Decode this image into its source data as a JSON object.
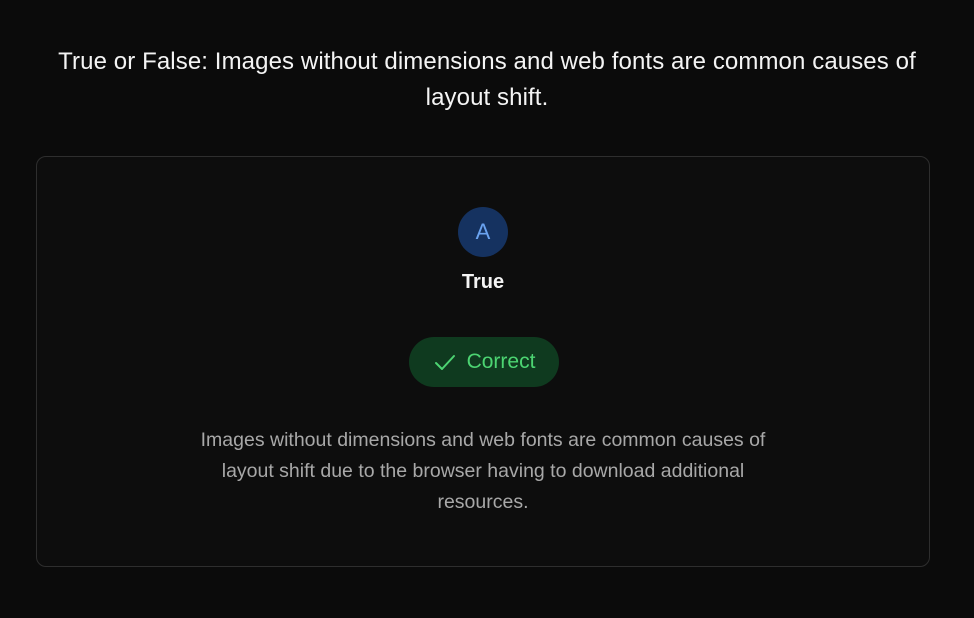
{
  "question": {
    "text": "True or False: Images without dimensions and web fonts are common causes of layout shift."
  },
  "answer": {
    "letter": "A",
    "text": "True",
    "letter_color": "#6aa3f0",
    "letter_bg": "#153260"
  },
  "result": {
    "icon": "check-icon",
    "label": "Correct",
    "color": "#4cd472",
    "bg": "#0f3a1f"
  },
  "explanation": {
    "text": "Images without dimensions and web fonts are common causes of layout shift due to the browser having to download additional resources."
  }
}
